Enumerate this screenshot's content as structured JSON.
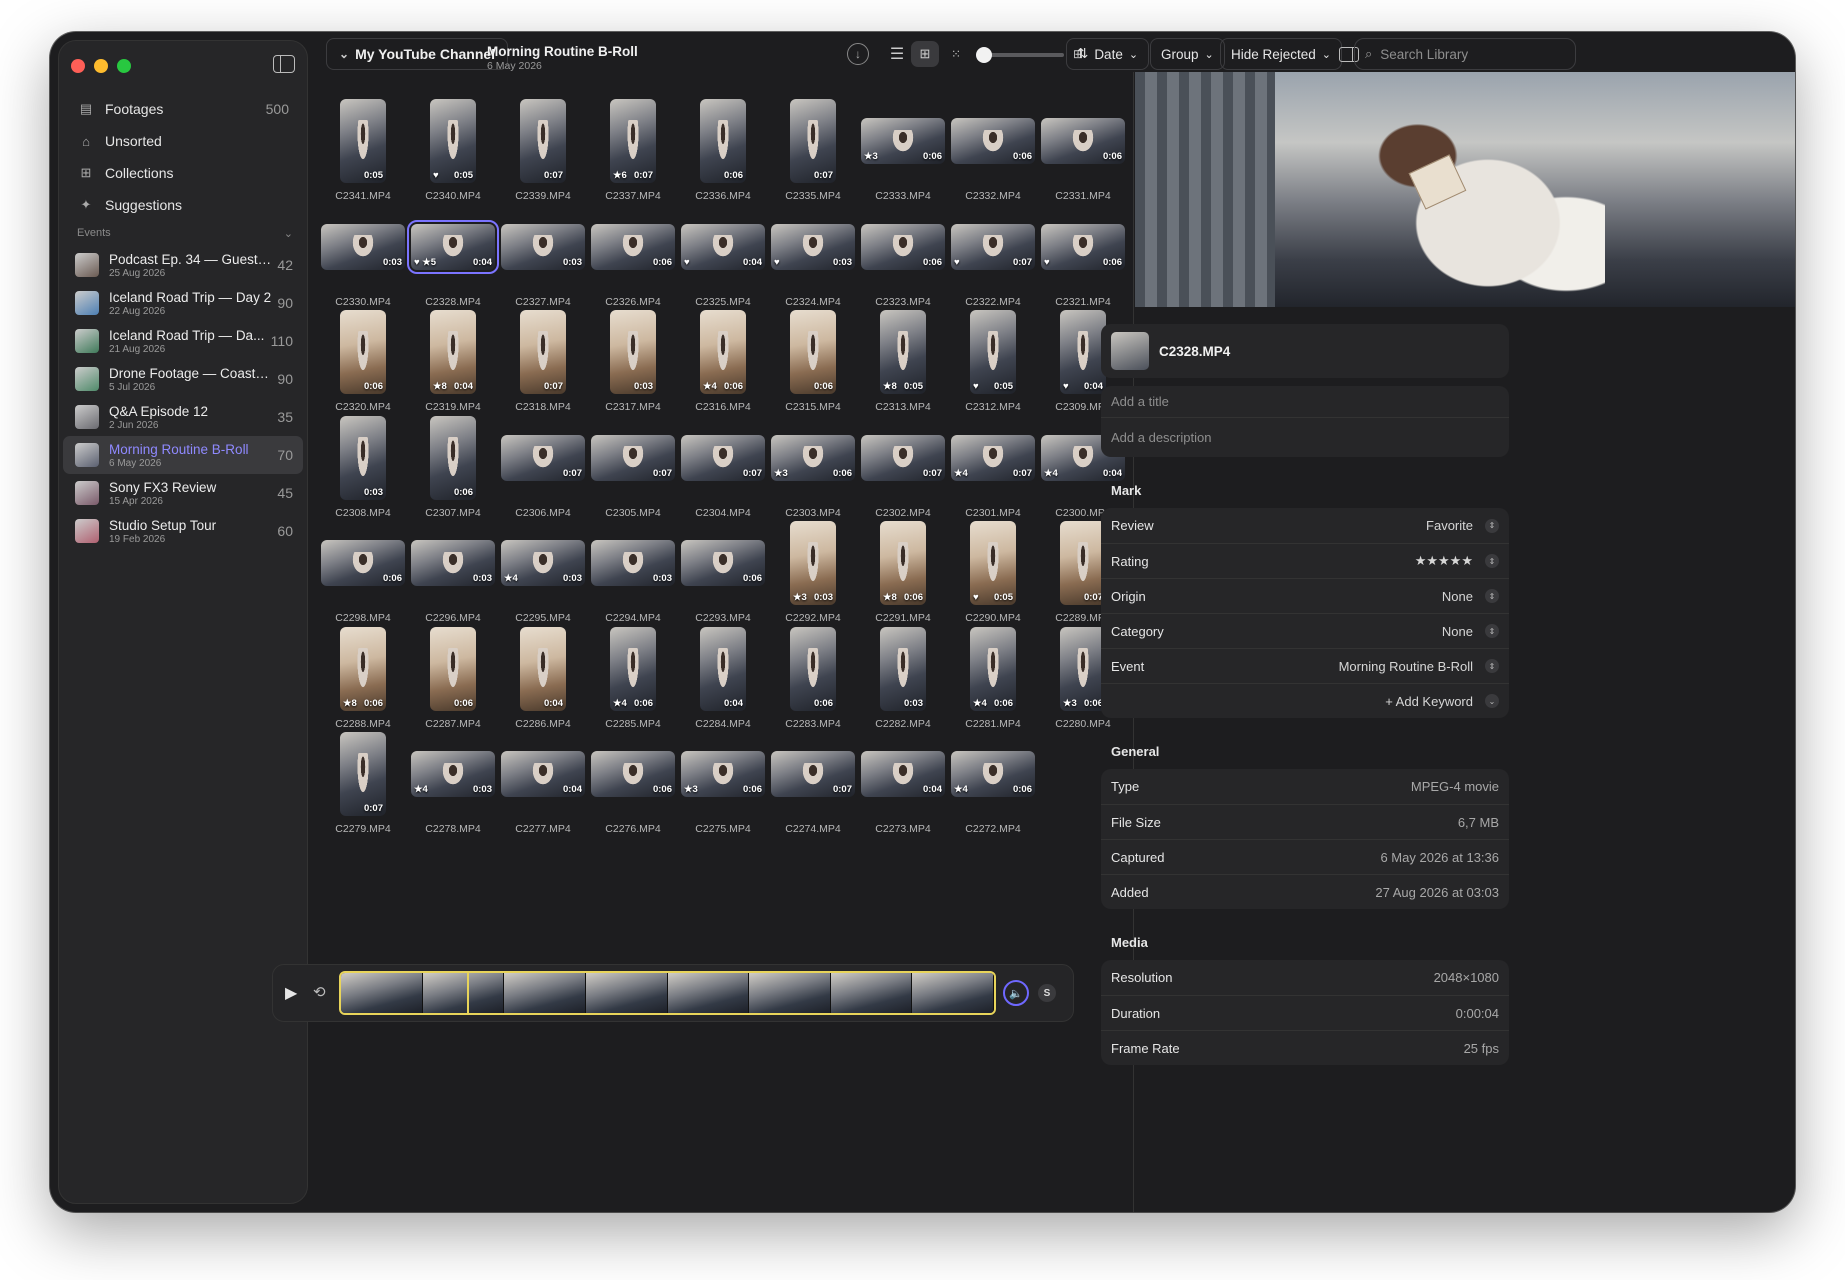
{
  "sidebar": {
    "nav": [
      {
        "label": "Footages",
        "count": "500",
        "icon": "film-stack-icon",
        "glyph": "▤"
      },
      {
        "label": "Unsorted",
        "count": "",
        "icon": "tray-icon",
        "glyph": "⌂"
      },
      {
        "label": "Collections",
        "count": "",
        "icon": "grid-four-icon",
        "glyph": "⊞"
      },
      {
        "label": "Suggestions",
        "count": "",
        "icon": "sparkles-icon",
        "glyph": "✦"
      }
    ],
    "events_header": "Events",
    "events": [
      {
        "name": "Podcast Ep. 34 — Guest:...",
        "date": "25 Aug 2026",
        "count": "42",
        "color": "#6a5a52"
      },
      {
        "name": "Iceland Road Trip — Day 2",
        "date": "22 Aug 2026",
        "count": "90",
        "color": "#4d7fb3"
      },
      {
        "name": "Iceland Road Trip — Da...",
        "date": "21 Aug 2026",
        "count": "110",
        "color": "#3f7a5a"
      },
      {
        "name": "Drone Footage — Coastli...",
        "date": "5 Jul 2026",
        "count": "90",
        "color": "#4f8a6a"
      },
      {
        "name": "Q&A Episode 12",
        "date": "2 Jun 2026",
        "count": "35",
        "color": "#6a6a70"
      },
      {
        "name": "Morning Routine B-Roll",
        "date": "6 May 2026",
        "count": "70",
        "color": "#5b6070"
      },
      {
        "name": "Sony FX3 Review",
        "date": "15 Apr 2026",
        "count": "45",
        "color": "#7a5a6a"
      },
      {
        "name": "Studio Setup Tour",
        "date": "19 Feb 2026",
        "count": "60",
        "color": "#b06070"
      }
    ]
  },
  "toolbar": {
    "channel": "My YouTube Channel",
    "title": "Morning Routine B-Roll",
    "subtitle": "6 May 2026",
    "sort": "Date",
    "group": "Group",
    "filter": "Hide Rejected",
    "search_placeholder": "Search Library"
  },
  "clips": [
    {
      "name": "C2341.MP4",
      "o": "p",
      "d": "0:05",
      "b": ""
    },
    {
      "name": "C2340.MP4",
      "o": "p",
      "d": "0:05",
      "b": "♥"
    },
    {
      "name": "C2339.MP4",
      "o": "p",
      "d": "0:07",
      "b": ""
    },
    {
      "name": "C2337.MP4",
      "o": "p",
      "d": "0:07",
      "b": "★6"
    },
    {
      "name": "C2336.MP4",
      "o": "p",
      "d": "0:06",
      "b": ""
    },
    {
      "name": "C2335.MP4",
      "o": "p",
      "d": "0:07",
      "b": ""
    },
    {
      "name": "C2333.MP4",
      "o": "l",
      "d": "0:06",
      "b": "★3"
    },
    {
      "name": "C2332.MP4",
      "o": "l",
      "d": "0:06",
      "b": ""
    },
    {
      "name": "C2331.MP4",
      "o": "l",
      "d": "0:06",
      "b": ""
    },
    {
      "name": "C2330.MP4",
      "o": "l",
      "d": "0:03",
      "b": ""
    },
    {
      "name": "C2328.MP4",
      "o": "l",
      "d": "0:04",
      "b": "♥ ★5",
      "sel": true
    },
    {
      "name": "C2327.MP4",
      "o": "l",
      "d": "0:03",
      "b": ""
    },
    {
      "name": "C2326.MP4",
      "o": "l",
      "d": "0:06",
      "b": ""
    },
    {
      "name": "C2325.MP4",
      "o": "l",
      "d": "0:04",
      "b": "♥"
    },
    {
      "name": "C2324.MP4",
      "o": "l",
      "d": "0:03",
      "b": "♥"
    },
    {
      "name": "C2323.MP4",
      "o": "l",
      "d": "0:06",
      "b": ""
    },
    {
      "name": "C2322.MP4",
      "o": "l",
      "d": "0:07",
      "b": "♥"
    },
    {
      "name": "C2321.MP4",
      "o": "l",
      "d": "0:06",
      "b": "♥"
    },
    {
      "name": "C2320.MP4",
      "o": "pw",
      "d": "0:06",
      "b": ""
    },
    {
      "name": "C2319.MP4",
      "o": "pw",
      "d": "0:04",
      "b": "★8"
    },
    {
      "name": "C2318.MP4",
      "o": "pw",
      "d": "0:07",
      "b": ""
    },
    {
      "name": "C2317.MP4",
      "o": "pw",
      "d": "0:03",
      "b": ""
    },
    {
      "name": "C2316.MP4",
      "o": "pw",
      "d": "0:06",
      "b": "★4"
    },
    {
      "name": "C2315.MP4",
      "o": "pw",
      "d": "0:06",
      "b": ""
    },
    {
      "name": "C2313.MP4",
      "o": "p",
      "d": "0:05",
      "b": "★8"
    },
    {
      "name": "C2312.MP4",
      "o": "p",
      "d": "0:05",
      "b": "♥"
    },
    {
      "name": "C2309.MP4",
      "o": "p",
      "d": "0:04",
      "b": "♥"
    },
    {
      "name": "C2308.MP4",
      "o": "p",
      "d": "0:03",
      "b": ""
    },
    {
      "name": "C2307.MP4",
      "o": "p",
      "d": "0:06",
      "b": ""
    },
    {
      "name": "C2306.MP4",
      "o": "l",
      "d": "0:07",
      "b": ""
    },
    {
      "name": "C2305.MP4",
      "o": "l",
      "d": "0:07",
      "b": ""
    },
    {
      "name": "C2304.MP4",
      "o": "l",
      "d": "0:07",
      "b": ""
    },
    {
      "name": "C2303.MP4",
      "o": "l",
      "d": "0:06",
      "b": "★3"
    },
    {
      "name": "C2302.MP4",
      "o": "l",
      "d": "0:07",
      "b": ""
    },
    {
      "name": "C2301.MP4",
      "o": "l",
      "d": "0:07",
      "b": "★4"
    },
    {
      "name": "C2300.MP4",
      "o": "l",
      "d": "0:04",
      "b": "★4"
    },
    {
      "name": "C2298.MP4",
      "o": "l",
      "d": "0:06",
      "b": ""
    },
    {
      "name": "C2296.MP4",
      "o": "l",
      "d": "0:03",
      "b": ""
    },
    {
      "name": "C2295.MP4",
      "o": "l",
      "d": "0:03",
      "b": "★4"
    },
    {
      "name": "C2294.MP4",
      "o": "l",
      "d": "0:03",
      "b": ""
    },
    {
      "name": "C2293.MP4",
      "o": "l",
      "d": "0:06",
      "b": ""
    },
    {
      "name": "C2292.MP4",
      "o": "pw",
      "d": "0:03",
      "b": "★3"
    },
    {
      "name": "C2291.MP4",
      "o": "pw",
      "d": "0:06",
      "b": "★8"
    },
    {
      "name": "C2290.MP4",
      "o": "pw",
      "d": "0:05",
      "b": "♥"
    },
    {
      "name": "C2289.MP4",
      "o": "pw",
      "d": "0:07",
      "b": ""
    },
    {
      "name": "C2288.MP4",
      "o": "pw",
      "d": "0:06",
      "b": "★8"
    },
    {
      "name": "C2287.MP4",
      "o": "pw",
      "d": "0:06",
      "b": ""
    },
    {
      "name": "C2286.MP4",
      "o": "pw",
      "d": "0:04",
      "b": ""
    },
    {
      "name": "C2285.MP4",
      "o": "p",
      "d": "0:06",
      "b": "★4"
    },
    {
      "name": "C2284.MP4",
      "o": "p",
      "d": "0:04",
      "b": ""
    },
    {
      "name": "C2283.MP4",
      "o": "p",
      "d": "0:06",
      "b": ""
    },
    {
      "name": "C2282.MP4",
      "o": "p",
      "d": "0:03",
      "b": ""
    },
    {
      "name": "C2281.MP4",
      "o": "p",
      "d": "0:06",
      "b": "★4"
    },
    {
      "name": "C2280.MP4",
      "o": "p",
      "d": "0:06",
      "b": "★3"
    },
    {
      "name": "C2279.MP4",
      "o": "p",
      "d": "0:07",
      "b": ""
    },
    {
      "name": "C2278.MP4",
      "o": "l",
      "d": "0:03",
      "b": "★4"
    },
    {
      "name": "C2277.MP4",
      "o": "l",
      "d": "0:04",
      "b": ""
    },
    {
      "name": "C2276.MP4",
      "o": "l",
      "d": "0:06",
      "b": ""
    },
    {
      "name": "C2275.MP4",
      "o": "l",
      "d": "0:06",
      "b": "★3"
    },
    {
      "name": "C2274.MP4",
      "o": "l",
      "d": "0:07",
      "b": ""
    },
    {
      "name": "C2273.MP4",
      "o": "l",
      "d": "0:04",
      "b": ""
    },
    {
      "name": "C2272.MP4",
      "o": "l",
      "d": "0:06",
      "b": "★4"
    }
  ],
  "inspector": {
    "file_name": "C2328.MP4",
    "title_placeholder": "Add a title",
    "description_placeholder": "Add a description",
    "mark_header": "Mark",
    "mark": [
      {
        "label": "Review",
        "value": "Favorite"
      },
      {
        "label": "Rating",
        "value": "★★★★★"
      },
      {
        "label": "Origin",
        "value": "None"
      },
      {
        "label": "Category",
        "value": "None"
      },
      {
        "label": "Event",
        "value": "Morning Routine B-Roll"
      }
    ],
    "add_keyword": "+ Add Keyword",
    "general_header": "General",
    "general": [
      {
        "label": "Type",
        "value": "MPEG-4 movie"
      },
      {
        "label": "File Size",
        "value": "6,7 MB"
      },
      {
        "label": "Captured",
        "value": "6 May 2026 at 13:36"
      },
      {
        "label": "Added",
        "value": "27 Aug 2026 at 03:03"
      }
    ],
    "media_header": "Media",
    "media": [
      {
        "label": "Resolution",
        "value": "2048×1080"
      },
      {
        "label": "Duration",
        "value": "0:00:04"
      },
      {
        "label": "Frame Rate",
        "value": "25 fps"
      }
    ]
  },
  "player": {
    "s_badge": "S"
  },
  "colors": {
    "accent": "#7b74ff",
    "playhead": "#e8d45a",
    "close": "#fe5f57",
    "minimize": "#febc2e",
    "zoom": "#28c840"
  }
}
